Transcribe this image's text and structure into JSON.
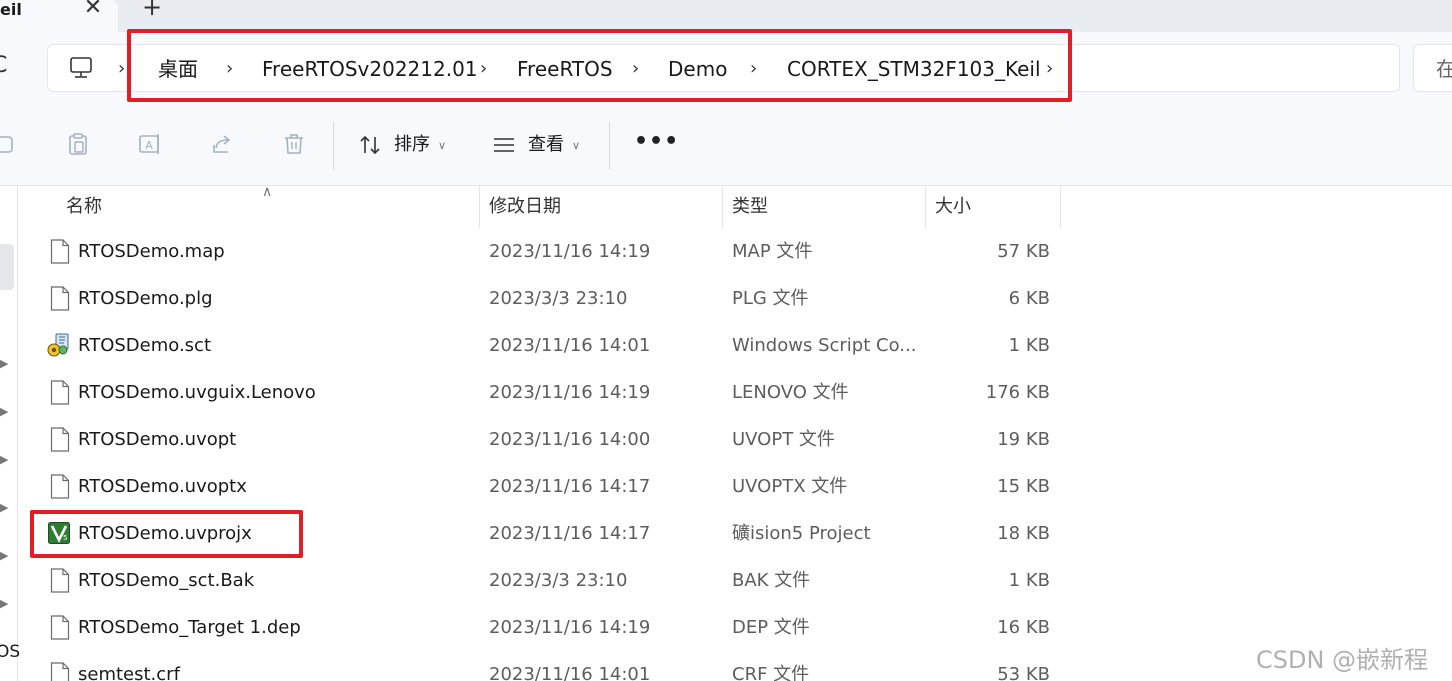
{
  "tab": {
    "title": "eil",
    "close_glyph": "✕",
    "new_tab_glyph": "+"
  },
  "nav": {
    "refresh_glyph": "C",
    "partial_label": "OS"
  },
  "breadcrumb": {
    "separator": "›",
    "items": [
      "桌面",
      "FreeRTOSv202212.01",
      "FreeRTOS",
      "Demo",
      "CORTEX_STM32F103_Keil"
    ]
  },
  "search": {
    "partial_text": "在"
  },
  "toolbar": {
    "sort_label": "排序",
    "view_label": "查看",
    "more_label": "•••"
  },
  "columns": {
    "name": "名称",
    "date": "修改日期",
    "type": "类型",
    "size": "大小"
  },
  "files": [
    {
      "name": "RTOSDemo.map",
      "date": "2023/11/16 14:19",
      "type": "MAP 文件",
      "size": "57 KB",
      "icon": "document-icon"
    },
    {
      "name": "RTOSDemo.plg",
      "date": "2023/3/3 23:10",
      "type": "PLG 文件",
      "size": "6 KB",
      "icon": "document-icon"
    },
    {
      "name": "RTOSDemo.sct",
      "date": "2023/11/16 14:01",
      "type": "Windows Script Co...",
      "size": "1 KB",
      "icon": "script-icon"
    },
    {
      "name": "RTOSDemo.uvguix.Lenovo",
      "date": "2023/11/16 14:19",
      "type": "LENOVO 文件",
      "size": "176 KB",
      "icon": "document-icon"
    },
    {
      "name": "RTOSDemo.uvopt",
      "date": "2023/11/16 14:00",
      "type": "UVOPT 文件",
      "size": "19 KB",
      "icon": "document-icon"
    },
    {
      "name": "RTOSDemo.uvoptx",
      "date": "2023/11/16 14:17",
      "type": "UVOPTX 文件",
      "size": "15 KB",
      "icon": "document-icon"
    },
    {
      "name": "RTOSDemo.uvprojx",
      "date": "2023/11/16 14:17",
      "type": "礦ision5 Project",
      "size": "18 KB",
      "icon": "keil-project-icon"
    },
    {
      "name": "RTOSDemo_sct.Bak",
      "date": "2023/3/3 23:10",
      "type": "BAK 文件",
      "size": "1 KB",
      "icon": "document-icon"
    },
    {
      "name": "RTOSDemo_Target 1.dep",
      "date": "2023/11/16 14:19",
      "type": "DEP 文件",
      "size": "16 KB",
      "icon": "document-icon"
    },
    {
      "name": "semtest.crf",
      "date": "2023/11/16 14:01",
      "type": "CRF 文件",
      "size": "53 KB",
      "icon": "document-icon"
    }
  ],
  "watermark": "CSDN @嵌新程",
  "colors": {
    "highlight": "#e01e28",
    "keil_icon": "#2e7d32"
  }
}
